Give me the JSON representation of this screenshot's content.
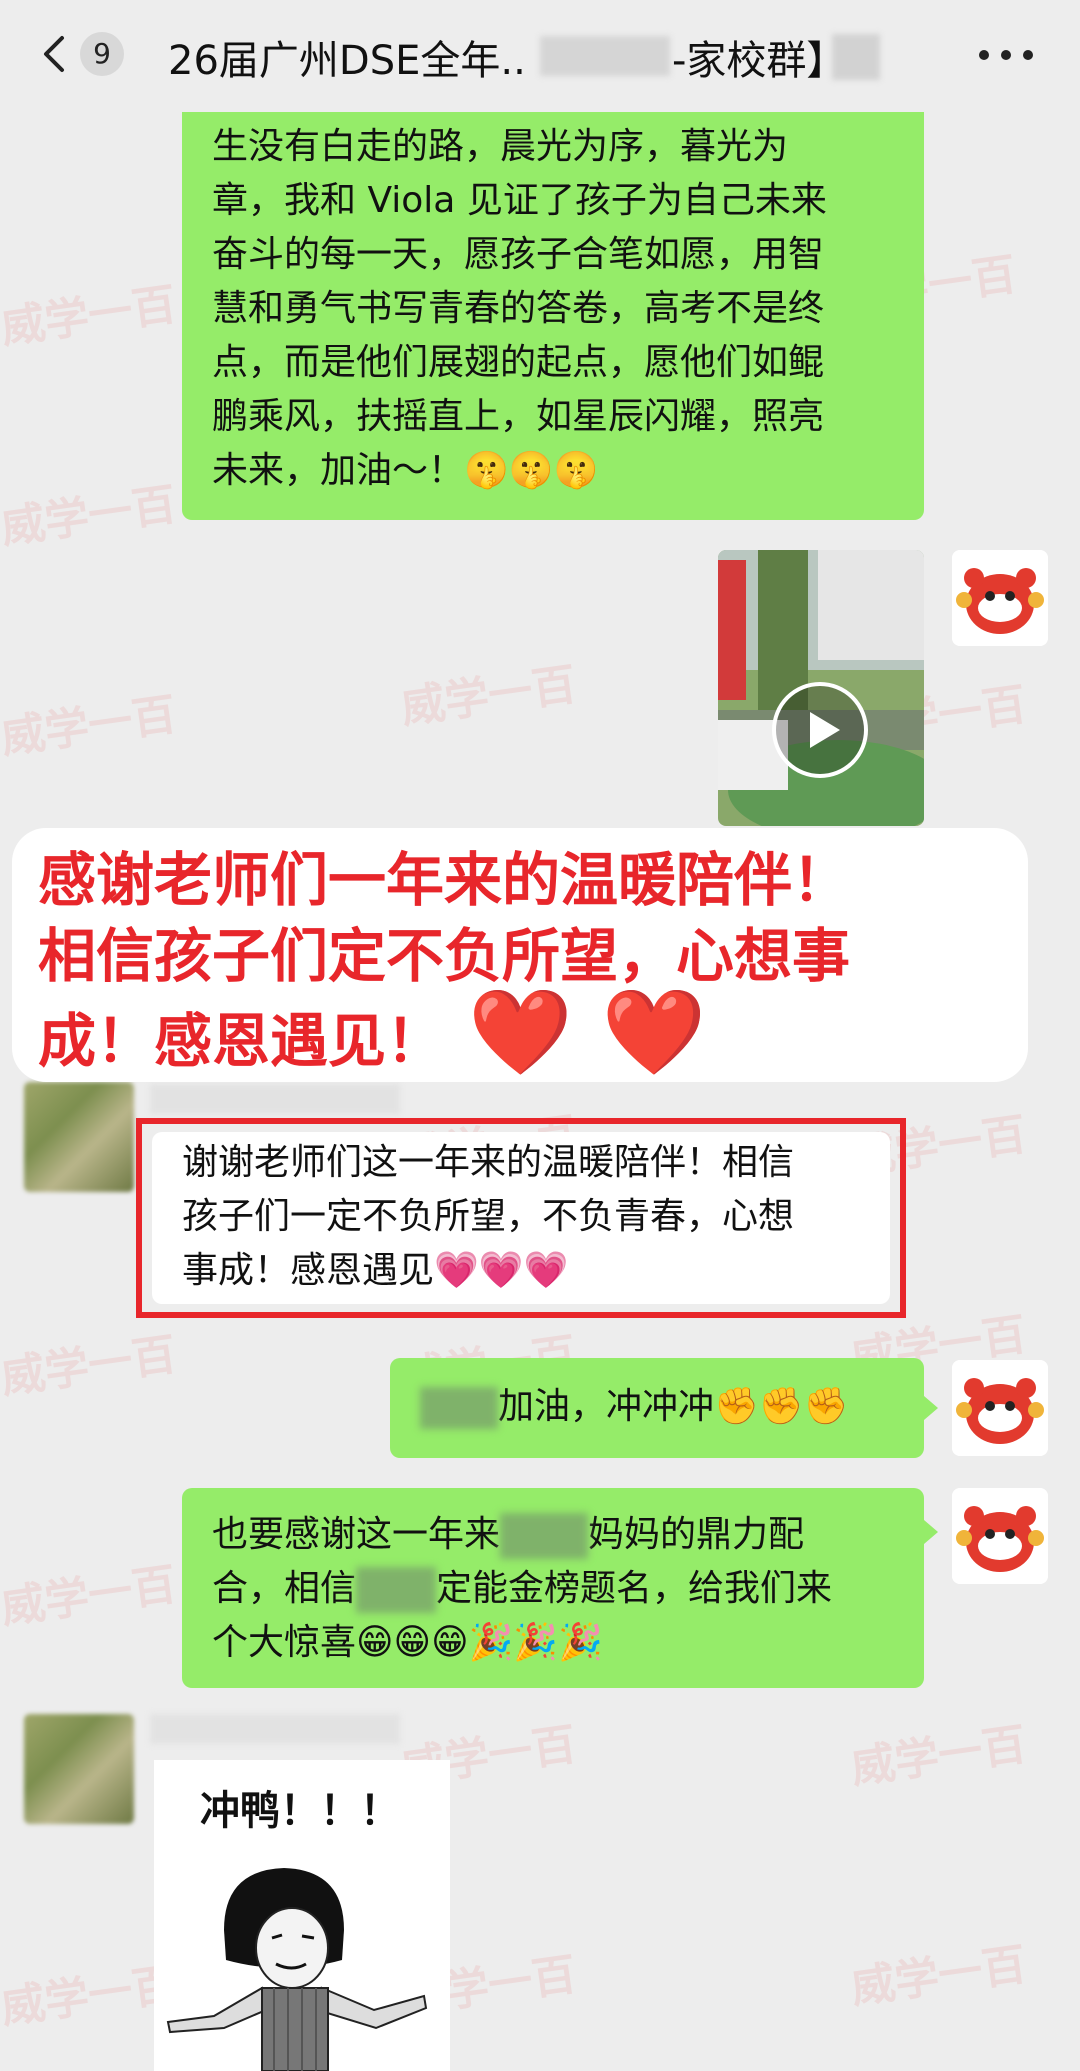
{
  "header": {
    "back_count": "9",
    "title_left": "26届广州DSE全年..",
    "title_right": "-家校群】"
  },
  "messages": {
    "m1_lines": [
      "生没有白走的路，晨光为序，暮光为",
      "章，我和 Viola 见证了孩子为自己未来",
      "奋斗的每一天，愿孩子合笔如愿，用智",
      "慧和勇气书写青春的答卷，高考不是终",
      "点，而是他们展翅的起点，愿他们如鲲",
      "鹏乘风，扶摇直上，如星辰闪耀，照亮",
      "未来，加油～！"
    ],
    "m1_emojis": "🤫🤫🤫",
    "m3_lines": [
      "谢谢老师们这一年来的温暖陪伴！相信",
      "孩子们一定不负所望，不负青春，心想",
      "事成！感恩遇见"
    ],
    "m3_emojis": "💗💗💗",
    "m4_text": "加油，冲冲冲",
    "m4_emojis": "✊✊✊",
    "m5_line1_a": "也要感谢这一年来",
    "m5_line1_b": "妈妈的鼎力配",
    "m5_line2_a": "合，相信",
    "m5_line2_b": "定能金榜题名，给我们来",
    "m5_line3": "个大惊喜",
    "m5_emojis": "😁😁😁🎉🎉🎉",
    "meme_text": "冲鸭！！！"
  },
  "banner": {
    "line1": "感谢老师们一年来的温暖陪伴！",
    "line2": "相信孩子们定不负所望，心想事",
    "line3": "成！感恩遇见！",
    "hearts": "❤️ ❤️"
  },
  "watermark": "威学一百",
  "colors": {
    "bubble_green": "#95ec69",
    "accent_red": "#e8262b",
    "background": "#ededed"
  }
}
